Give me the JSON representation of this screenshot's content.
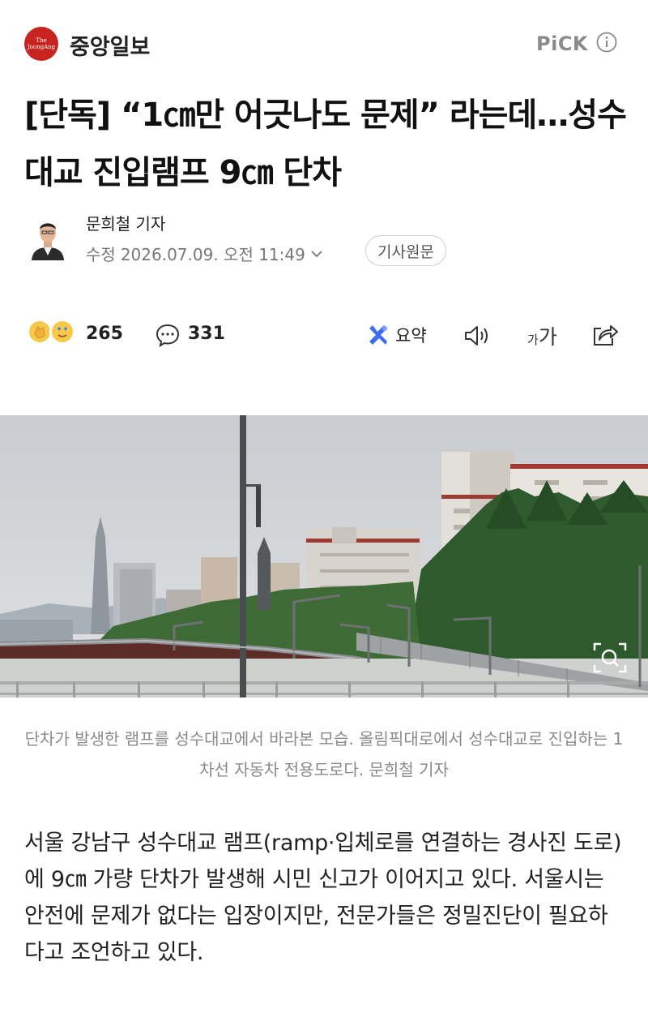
{
  "publisher": {
    "logo_text": "The JoongAng",
    "name": "중앙일보",
    "pick_label": "PiCK"
  },
  "article": {
    "headline": "[단독] “1㎝만 어긋나도 문제” 라는데…성수대교 진입램프 9㎝ 단차",
    "author": "문희철 기자",
    "modified_label": "수정",
    "timestamp": "2026.07.09. 오전 11:49",
    "original_button": "기사원문"
  },
  "actions": {
    "reaction_count": "265",
    "comment_count": "331",
    "summary_label": "요약",
    "font_small": "가",
    "font_large": "가"
  },
  "photo": {
    "caption": "단차가 발생한 램프를 성수대교에서 바라본 모습. 올림픽대로에서 성수대교로 진입하는 1차선 자동차 전용도로다. 문희철 기자"
  },
  "body": {
    "paragraph": "서울 강남구 성수대교 램프(ramp·입체로를 연결하는 경사진 도로)에 9㎝ 가량 단차가 발생해 시민 신고가 이어지고 있다. 서울시는 안전에 문제가 없다는 입장이지만, 전문가들은 정밀진단이 필요하다고 조언하고 있다."
  },
  "colors": {
    "brand_red": "#c8241f",
    "muted_text": "#8a8a8a",
    "summary_icon": "#3f6df0"
  },
  "icons": [
    "info-icon",
    "chevron-down-icon",
    "clap-emoji-icon",
    "heart-eyes-emoji-icon",
    "comment-icon",
    "summary-icon",
    "speaker-icon",
    "share-icon",
    "zoom-icon"
  ]
}
